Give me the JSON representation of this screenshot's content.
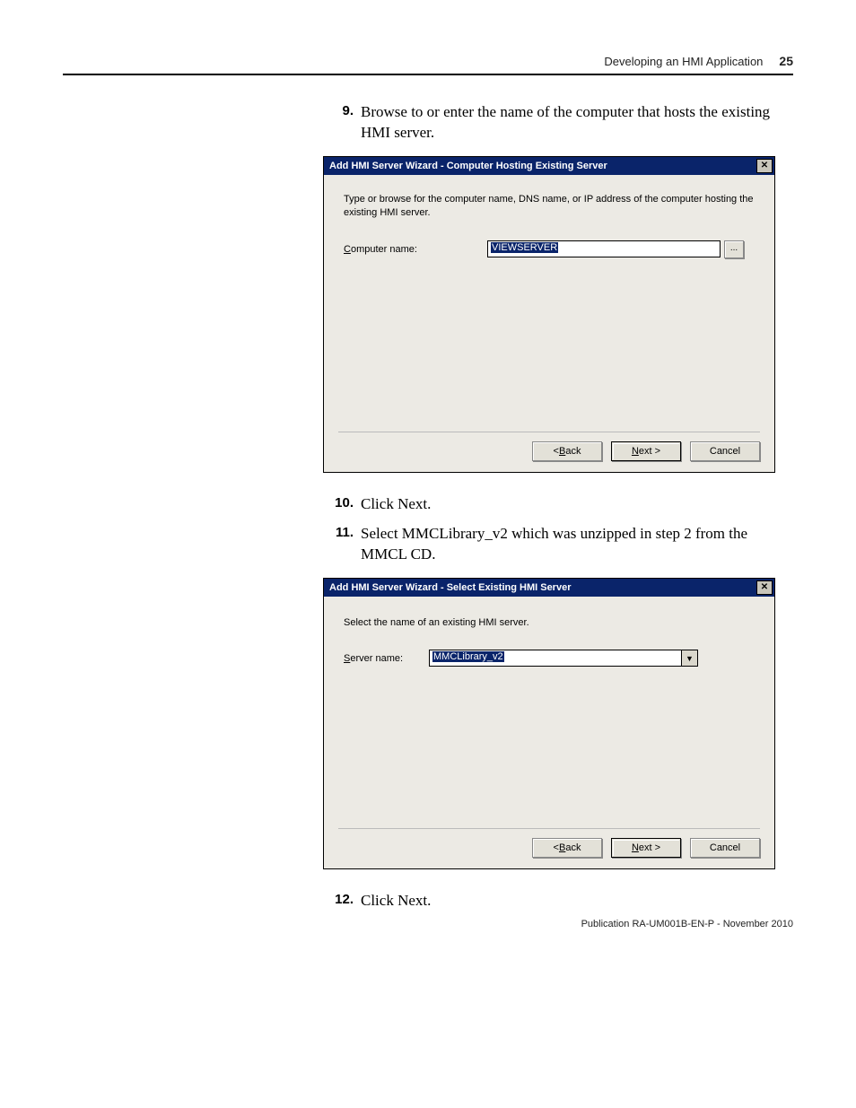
{
  "header": {
    "chapter": "Developing an HMI Application",
    "page_number": "25"
  },
  "steps": {
    "s9": {
      "num": "9.",
      "text": "Browse to or enter the name of the computer that hosts the existing HMI server."
    },
    "s10": {
      "num": "10.",
      "text": "Click Next."
    },
    "s11": {
      "num": "11.",
      "text": "Select MMCLibrary_v2 which was unzipped in step 2 from the MMCL CD."
    },
    "s12": {
      "num": "12.",
      "text": "Click Next."
    }
  },
  "dialog1": {
    "title": "Add HMI Server Wizard - Computer Hosting Existing Server",
    "close_glyph": "✕",
    "description": "Type or browse for the computer name, DNS name, or IP address of the computer hosting the existing HMI server.",
    "label_underline": "C",
    "label_rest": "omputer name:",
    "value": "VIEWSERVER",
    "browse_glyph": "...",
    "btn_back_u": "B",
    "btn_back_rest": "ack",
    "btn_back_prefix": "< ",
    "btn_next_u": "N",
    "btn_next_rest": "ext >",
    "btn_cancel": "Cancel"
  },
  "dialog2": {
    "title": "Add HMI Server Wizard - Select Existing HMI Server",
    "close_glyph": "✕",
    "description": "Select the name of an existing HMI server.",
    "label_underline": "S",
    "label_rest": "erver name:",
    "value": "MMCLibrary_v2",
    "arrow_glyph": "▼",
    "btn_back_u": "B",
    "btn_back_rest": "ack",
    "btn_back_prefix": "< ",
    "btn_next_u": "N",
    "btn_next_rest": "ext >",
    "btn_cancel": "Cancel"
  },
  "footer": {
    "text": "Publication RA-UM001B-EN-P - November 2010"
  }
}
